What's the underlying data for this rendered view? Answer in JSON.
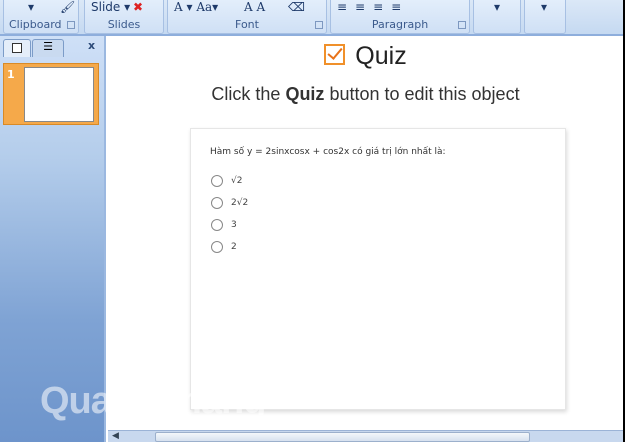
{
  "ribbon": {
    "groups": [
      {
        "label": "Clipboard"
      },
      {
        "label": "Slides",
        "slide_button": "Slide"
      },
      {
        "label": "Font"
      },
      {
        "label": "Paragraph"
      }
    ]
  },
  "left_panel": {
    "close": "x",
    "slide_number": "1"
  },
  "slide": {
    "title": "Quiz",
    "subtitle_pre": "Click the ",
    "subtitle_bold": "Quiz",
    "subtitle_post": " button to edit this object",
    "question": "Hàm số y = 2sinxcosx + cos2x có giá trị lớn nhất là:",
    "options": [
      "√2",
      "2√2",
      "3",
      "2"
    ]
  },
  "watermark": "Quantrimang"
}
